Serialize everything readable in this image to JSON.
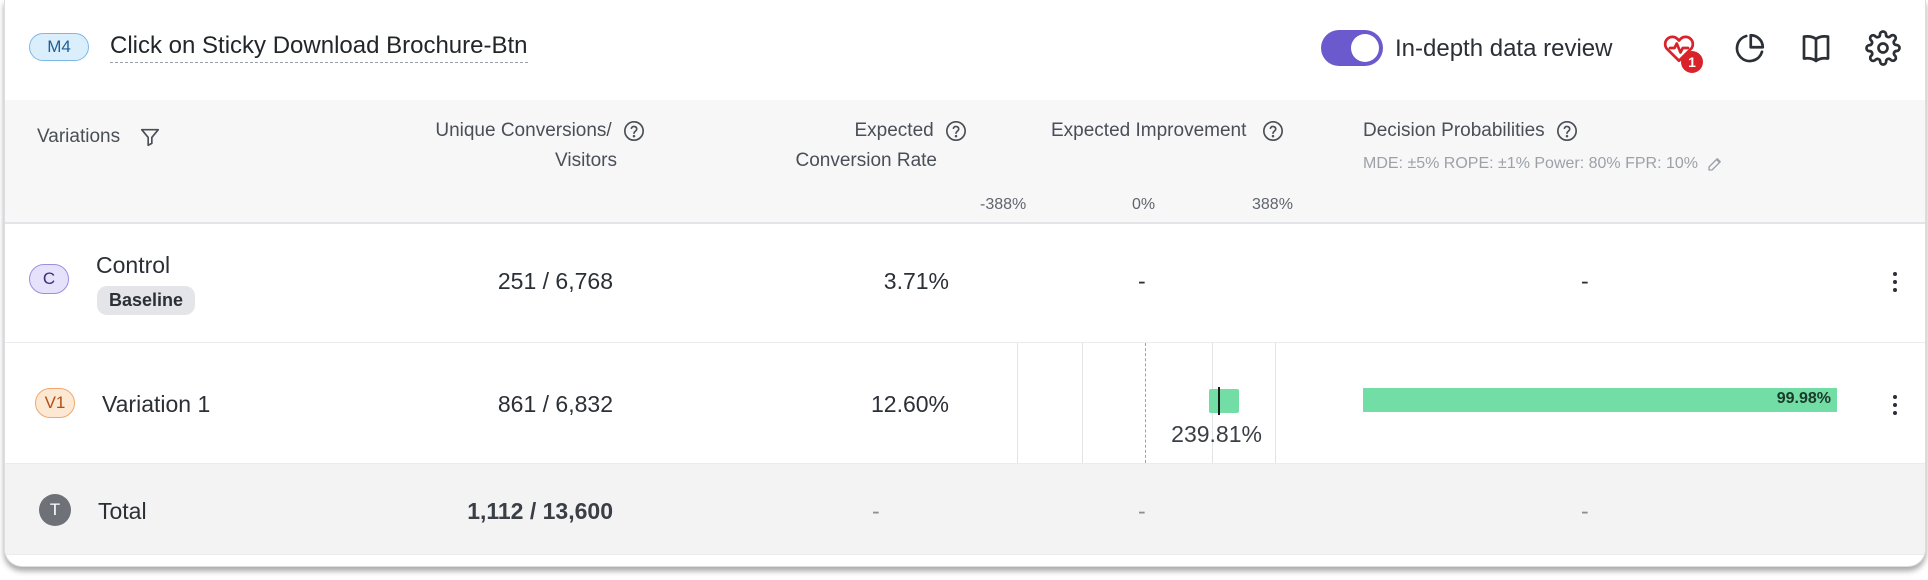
{
  "header": {
    "goal_badge": "M4",
    "goal_title": "Click on Sticky Download Brochure-Btn",
    "toggle_label": "In-depth data review",
    "toggle_on": true,
    "health_notifications": "1",
    "icons": [
      "heart-pulse-icon",
      "pie-chart-icon",
      "book-icon",
      "gear-icon"
    ]
  },
  "columns": {
    "variations": "Variations",
    "unique_conversions_line1": "Unique Conversions/",
    "unique_conversions_line2": "Visitors",
    "expected_line1": "Expected",
    "expected_line2": "Conversion Rate",
    "expected_improvement": "Expected Improvement",
    "decision_probabilities": "Decision Probabilities",
    "decision_meta": "MDE: ±5%  ROPE: ±1%  Power: 80%  FPR: 10%",
    "axis_ticks": [
      "-388%",
      "0%",
      "388%"
    ]
  },
  "rows": [
    {
      "avatar": "C",
      "name": "Control",
      "tag": "Baseline",
      "conversions": "251 / 6,768",
      "rate": "3.71%",
      "improvement": "-",
      "probability": "-"
    },
    {
      "avatar": "V1",
      "name": "Variation 1",
      "conversions": "861 / 6,832",
      "rate": "12.60%",
      "improvement_label": "239.81%",
      "improvement_value": 239.81,
      "improvement_interval": [
        207,
        305
      ],
      "axis_range": [
        -388,
        388
      ],
      "probability_label": "99.98%",
      "probability_value": 0.9998
    }
  ],
  "total": {
    "avatar": "T",
    "name": "Total",
    "conversions": "1,112 / 13,600",
    "rate": "-",
    "improvement": "-",
    "probability": "-"
  },
  "colors": {
    "toggle": "#6a5acd",
    "bar_green": "#72dea5",
    "notification_red": "#d9232b",
    "control_avatar_bg": "#e7e2fb",
    "variation_avatar_bg": "#fde8d4",
    "total_avatar_bg": "#6e7178"
  }
}
